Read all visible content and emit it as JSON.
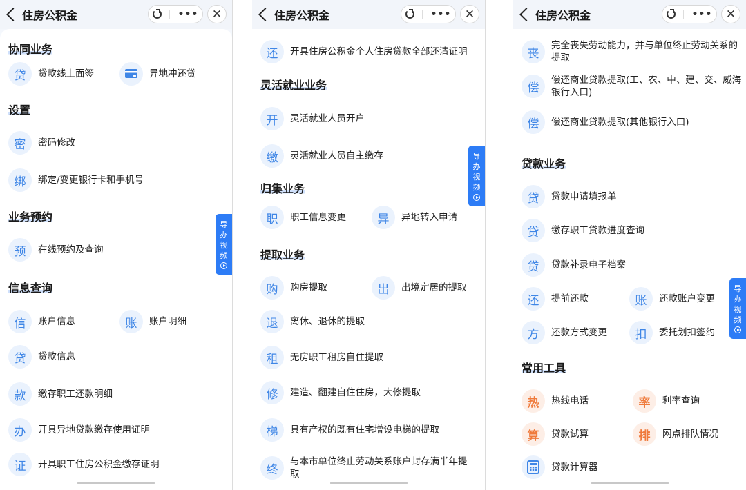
{
  "app_title": "住房公积金",
  "close_glyph": "✕",
  "more_glyph": "•••",
  "guide_text": [
    "导",
    "办",
    "视",
    "频"
  ],
  "accent_color": "#2d7cf6",
  "icon_color": "#3f86e6",
  "tool_icon_color": "#ef7a3b",
  "panel1": {
    "sections": {
      "xietong": "协同业务",
      "shezhi": "设置",
      "yuyue": "业务预约",
      "chaxun": "信息查询"
    },
    "items": [
      {
        "icon": "贷",
        "label": "贷款线上面签"
      },
      {
        "icon": "card",
        "label": "异地冲还贷"
      },
      {
        "icon": "密",
        "label": "密码修改"
      },
      {
        "icon": "绑",
        "label": "绑定/变更银行卡和手机号"
      },
      {
        "icon": "预",
        "label": "在线预约及查询"
      },
      {
        "icon": "信",
        "label": "账户信息"
      },
      {
        "icon": "账",
        "label": "账户明细"
      },
      {
        "icon": "贷",
        "label": "贷款信息"
      },
      {
        "icon": "款",
        "label": "缴存职工还款明细"
      },
      {
        "icon": "办",
        "label": "开具异地贷款缴存使用证明"
      },
      {
        "icon": "证",
        "label": "开具职工住房公积金缴存证明"
      }
    ]
  },
  "panel2": {
    "sections": {
      "linghuo": "灵活就业业务",
      "guiji": "归集业务",
      "tiqu": "提取业务"
    },
    "items": [
      {
        "icon": "还",
        "label": "开具住房公积金个人住房贷款全部还清证明"
      },
      {
        "icon": "开",
        "label": "灵活就业人员开户"
      },
      {
        "icon": "缴",
        "label": "灵活就业人员自主缴存"
      },
      {
        "icon": "职",
        "label": "职工信息变更"
      },
      {
        "icon": "异",
        "label": "异地转入申请"
      },
      {
        "icon": "购",
        "label": "购房提取"
      },
      {
        "icon": "出",
        "label": "出境定居的提取"
      },
      {
        "icon": "退",
        "label": "离休、退休的提取"
      },
      {
        "icon": "租",
        "label": "无房职工租房自住提取"
      },
      {
        "icon": "修",
        "label": "建造、翻建自住住房，大修提取"
      },
      {
        "icon": "梯",
        "label": "具有产权的既有住宅增设电梯的提取"
      },
      {
        "icon": "终",
        "label": "与本市单位终止劳动关系账户封存满半年提取"
      }
    ]
  },
  "panel3": {
    "sections": {
      "daikuan": "贷款业务",
      "gongju": "常用工具"
    },
    "items": [
      {
        "icon": "丧",
        "label": "完全丧失劳动能力，并与单位终止劳动关系的提取"
      },
      {
        "icon": "偿",
        "label": "偿还商业贷款提取(工、农、中、建、交、威海银行入口)"
      },
      {
        "icon": "偿",
        "label": "偿还商业贷款提取(其他银行入口)"
      },
      {
        "icon": "贷",
        "label": "贷款申请填报单"
      },
      {
        "icon": "贷",
        "label": "缴存职工贷款进度查询"
      },
      {
        "icon": "贷",
        "label": "贷款补录电子档案"
      },
      {
        "icon": "还",
        "label": "提前还款"
      },
      {
        "icon": "账",
        "label": "还款账户变更"
      },
      {
        "icon": "方",
        "label": "还款方式变更"
      },
      {
        "icon": "扣",
        "label": "委托划扣签约"
      },
      {
        "icon": "热",
        "label": "热线电话"
      },
      {
        "icon": "率",
        "label": "利率查询"
      },
      {
        "icon": "算",
        "label": "贷款试算"
      },
      {
        "icon": "排",
        "label": "网点排队情况"
      },
      {
        "icon": "calculator",
        "label": "贷款计算器"
      }
    ]
  }
}
